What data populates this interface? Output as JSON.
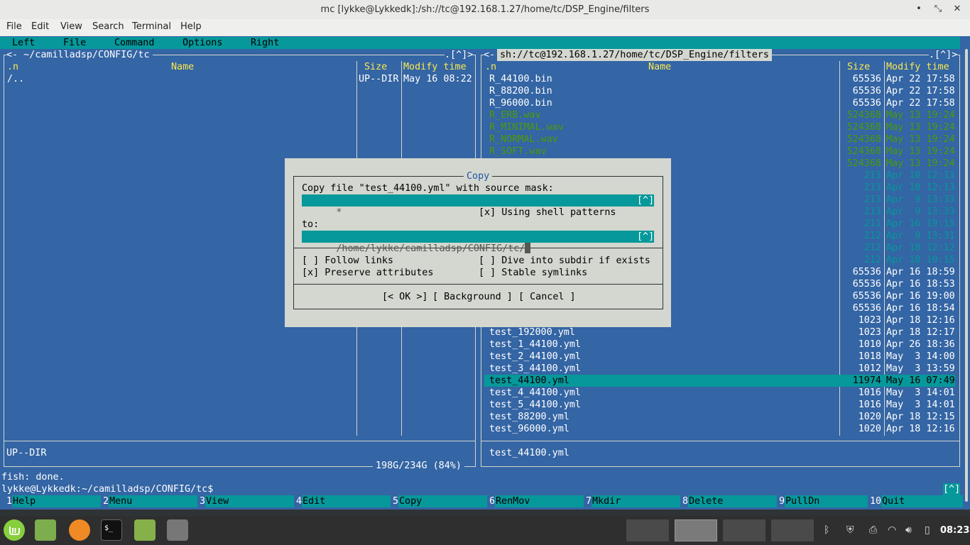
{
  "window": {
    "title": "mc [lykke@Lykkedk]:/sh://tc@192.168.1.27/home/tc/DSP_Engine/filters",
    "minimize_glyph": "•",
    "restore_glyph": "⤡",
    "close_glyph": "✕"
  },
  "app_menu": [
    "File",
    "Edit",
    "View",
    "Search",
    "Terminal",
    "Help"
  ],
  "mc_menu": [
    "Left",
    "File",
    "Command",
    "Options",
    "Right"
  ],
  "left_panel": {
    "header_left": "<- ~/camilladsp/CONFIG/tc",
    "header_right": ".[^]>",
    "col_n": ".n",
    "col_name": "Name",
    "col_size": "Size",
    "col_mtime": "Modify time",
    "row_name": "/..",
    "row_size": "UP--DIR",
    "row_mtime": "May 16 08:22",
    "status": "UP--DIR",
    "disk": "198G/234G (84%)"
  },
  "right_panel": {
    "header_left": "<-",
    "path": "sh://tc@192.168.1.27/home/tc/DSP_Engine/filters",
    "header_right": ".[^]>",
    "col_n": ".n",
    "col_name": "Name",
    "col_size": "Size",
    "col_mtime": "Modify time",
    "files": [
      {
        "name": "R_44100.bin",
        "size": "65536",
        "mtime": "Apr 22 17:58",
        "color": "w"
      },
      {
        "name": "R_88200.bin",
        "size": "65536",
        "mtime": "Apr 22 17:58",
        "color": "w"
      },
      {
        "name": "R_96000.bin",
        "size": "65536",
        "mtime": "Apr 22 17:58",
        "color": "w"
      },
      {
        "name": "R_ERB.wav",
        "size": "524368",
        "mtime": "May 13 19:24",
        "color": "g"
      },
      {
        "name": "R_MINIMAL.wav",
        "size": "524368",
        "mtime": "May 13 19:24",
        "color": "g"
      },
      {
        "name": "R_NORMAL.wav",
        "size": "524368",
        "mtime": "May 13 19:24",
        "color": "g"
      },
      {
        "name": "R_SOFT.wav",
        "size": "524368",
        "mtime": "May 13 19:24",
        "color": "g"
      },
      {
        "name": "",
        "size": "524368",
        "mtime": "May 13 19:24",
        "color": "g"
      },
      {
        "name": "",
        "size": "213",
        "mtime": "Apr 18 12:13",
        "color": "c"
      },
      {
        "name": "",
        "size": "213",
        "mtime": "Apr 18 12:13",
        "color": "c"
      },
      {
        "name": "",
        "size": "213",
        "mtime": "Apr  9 13:33",
        "color": "c"
      },
      {
        "name": "",
        "size": "213",
        "mtime": "Apr  9 13:33",
        "color": "c"
      },
      {
        "name": "",
        "size": "211",
        "mtime": "Apr 16 19:15",
        "color": "c"
      },
      {
        "name": "",
        "size": "212",
        "mtime": "Apr  9 13:31",
        "color": "c"
      },
      {
        "name": "",
        "size": "212",
        "mtime": "Apr 18 12:12",
        "color": "c"
      },
      {
        "name": "",
        "size": "212",
        "mtime": "Apr 18 10:15",
        "color": "c"
      },
      {
        "name": "",
        "size": "65536",
        "mtime": "Apr 16 18:59",
        "color": "w"
      },
      {
        "name": "",
        "size": "65536",
        "mtime": "Apr 16 18:53",
        "color": "w"
      },
      {
        "name": "",
        "size": "65536",
        "mtime": "Apr 16 19:00",
        "color": "w"
      },
      {
        "name": "",
        "size": "65536",
        "mtime": "Apr 16 18:54",
        "color": "w"
      },
      {
        "name": "",
        "size": "1023",
        "mtime": "Apr 18 12:16",
        "color": "w"
      },
      {
        "name": "test_192000.yml",
        "size": "1023",
        "mtime": "Apr 18 12:17",
        "color": "w"
      },
      {
        "name": "test_1_44100.yml",
        "size": "1010",
        "mtime": "Apr 26 18:36",
        "color": "w"
      },
      {
        "name": "test_2_44100.yml",
        "size": "1018",
        "mtime": "May  3 14:00",
        "color": "w"
      },
      {
        "name": "test_3_44100.yml",
        "size": "1012",
        "mtime": "May  3 13:59",
        "color": "w"
      },
      {
        "name": "test_44100.yml",
        "size": "11974",
        "mtime": "May 16 07:49",
        "color": "sel"
      },
      {
        "name": "test_4_44100.yml",
        "size": "1016",
        "mtime": "May  3 14:01",
        "color": "w"
      },
      {
        "name": "test_5_44100.yml",
        "size": "1016",
        "mtime": "May  3 14:01",
        "color": "w"
      },
      {
        "name": "test_88200.yml",
        "size": "1020",
        "mtime": "Apr 18 12:15",
        "color": "w"
      },
      {
        "name": "test_96000.yml",
        "size": "1020",
        "mtime": "Apr 18 12:16",
        "color": "w"
      }
    ],
    "status": "test_44100.yml"
  },
  "dialog": {
    "title": "Copy",
    "prompt": "Copy file \"test_44100.yml\" with source mask:",
    "mask_value": "*",
    "history_btn": "[^]",
    "shell_patterns": "[x] Using shell patterns",
    "to_label": "to:",
    "to_value": "/home/lykke/camilladsp/CONFIG/tc/",
    "follow_links": "[ ] Follow links",
    "dive_subdir": "[ ] Dive into subdir if exists",
    "preserve_attrs": "[x] Preserve attributes",
    "stable_symlinks": "[ ] Stable symlinks",
    "ok_button": "[< OK >]",
    "background_button": "[ Background ]",
    "cancel_button": "[ Cancel ]"
  },
  "shell": {
    "line1": "fish: done.",
    "prompt": "lykke@Lykkedk:~/camilladsp/CONFIG/tc$",
    "history_btn": "[^]"
  },
  "fkeys": [
    {
      "num": "1",
      "label": "Help"
    },
    {
      "num": "2",
      "label": "Menu"
    },
    {
      "num": "3",
      "label": "View"
    },
    {
      "num": "4",
      "label": "Edit"
    },
    {
      "num": "5",
      "label": "Copy"
    },
    {
      "num": "6",
      "label": "RenMov"
    },
    {
      "num": "7",
      "label": "Mkdir"
    },
    {
      "num": "8",
      "label": "Delete"
    },
    {
      "num": "9",
      "label": "PullDn"
    },
    {
      "num": "10",
      "label": "Quit"
    }
  ],
  "taskbar": {
    "clock": "08:23",
    "icons": [
      "mint-menu-icon",
      "files-icon",
      "firefox-icon",
      "terminal-icon",
      "folder-icon",
      "sound-settings-icon"
    ]
  }
}
